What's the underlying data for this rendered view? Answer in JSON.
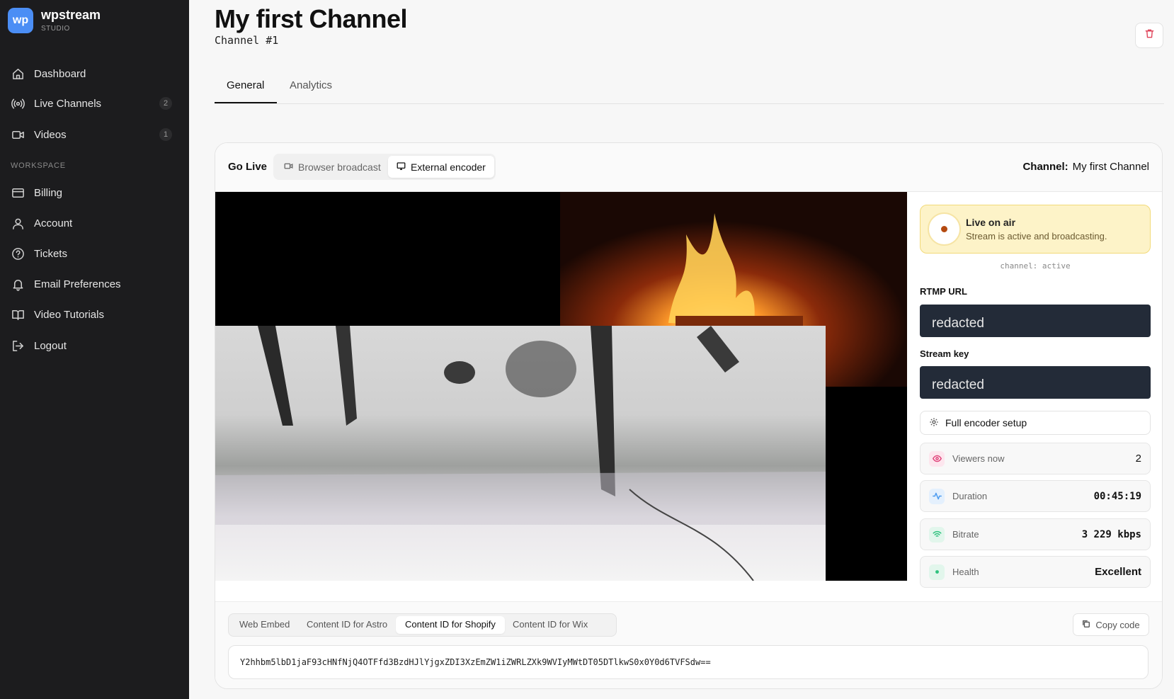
{
  "brand": {
    "logo_text": "wp",
    "name": "wpstream",
    "sub": "STUDIO"
  },
  "sidebar": {
    "items": [
      {
        "label": "Dashboard",
        "icon": "home-icon"
      },
      {
        "label": "Live Channels",
        "icon": "broadcast-icon",
        "count": "2"
      },
      {
        "label": "Videos",
        "icon": "video-camera-icon",
        "count": "1"
      }
    ],
    "workspace_label": "WORKSPACE",
    "workspace_items": [
      {
        "label": "Billing",
        "icon": "credit-card-icon"
      },
      {
        "label": "Account",
        "icon": "user-icon"
      },
      {
        "label": "Tickets",
        "icon": "help-circle-icon"
      },
      {
        "label": "Email Preferences",
        "icon": "bell-icon"
      },
      {
        "label": "Video Tutorials",
        "icon": "book-icon"
      },
      {
        "label": "Logout",
        "icon": "logout-icon"
      }
    ]
  },
  "header": {
    "title": "My first Channel",
    "subtitle": "Channel #1"
  },
  "tabs": [
    {
      "label": "General",
      "active": true
    },
    {
      "label": "Analytics",
      "active": false
    }
  ],
  "golive": {
    "label": "Go Live",
    "modes": [
      {
        "label": "Browser broadcast",
        "active": false
      },
      {
        "label": "External encoder",
        "active": true
      }
    ],
    "channel_prefix": "Channel:",
    "channel_name": "My first Channel"
  },
  "status": {
    "title": "Live on air",
    "subtitle": "Stream is active and broadcasting.",
    "channel_state": "channel: active",
    "color": "#b44a10"
  },
  "encoder": {
    "rtmp_label": "RTMP URL",
    "rtmp_value": "redacted",
    "key_label": "Stream key",
    "key_value": "redacted",
    "setup_label": "Full encoder setup"
  },
  "stats": [
    {
      "label": "Viewers now",
      "value": "2",
      "icon": "eye-icon",
      "color": "#e0457b"
    },
    {
      "label": "Duration",
      "value": "00:45:19",
      "icon": "activity-icon",
      "color": "#4b9bf0"
    },
    {
      "label": "Bitrate",
      "value": "3 229 kbps",
      "icon": "wifi-icon",
      "color": "#2ec27e"
    },
    {
      "label": "Health",
      "value": "Excellent",
      "icon": "dot-icon",
      "color": "#2ec27e"
    }
  ],
  "embed": {
    "tabs": [
      {
        "label": "Web Embed",
        "active": false
      },
      {
        "label": "Content ID for Astro",
        "active": false
      },
      {
        "label": "Content ID for Shopify",
        "active": true
      },
      {
        "label": "Content ID for Wix",
        "active": false
      }
    ],
    "copy_label": "Copy code",
    "code": "Y2hhbm5lbD1jaF93cHNfNjQ4OTFfd3BzdHJlYjgxZDI3XzEmZW1iZWRLZXk9WVIyMWtDT05DTlkwS0x0Y0d6TVFSdw=="
  }
}
